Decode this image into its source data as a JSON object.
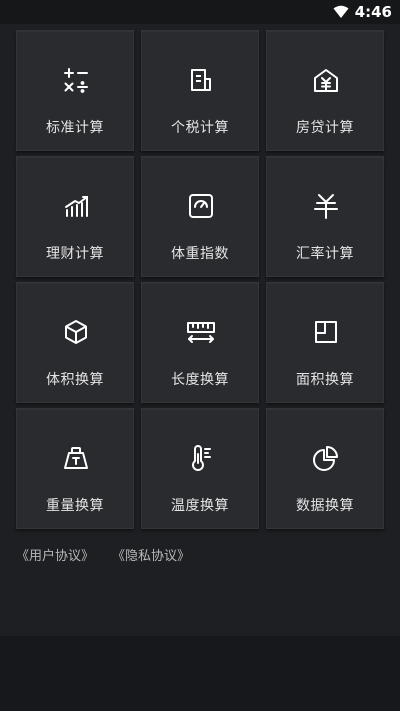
{
  "status_bar": {
    "time": "4:46",
    "icons": [
      "wifi-icon"
    ]
  },
  "tiles": [
    {
      "label": "标准计算",
      "icon": "calculator-symbols-icon"
    },
    {
      "label": "个税计算",
      "icon": "tax-document-icon"
    },
    {
      "label": "房贷计算",
      "icon": "house-yen-icon"
    },
    {
      "label": "理财计算",
      "icon": "growth-chart-icon"
    },
    {
      "label": "体重指数",
      "icon": "scale-dial-icon"
    },
    {
      "label": "汇率计算",
      "icon": "yen-icon"
    },
    {
      "label": "体积换算",
      "icon": "cube-icon"
    },
    {
      "label": "长度换算",
      "icon": "ruler-icon"
    },
    {
      "label": "面积换算",
      "icon": "area-square-icon"
    },
    {
      "label": "重量换算",
      "icon": "weight-icon"
    },
    {
      "label": "温度换算",
      "icon": "thermometer-icon"
    },
    {
      "label": "数据换算",
      "icon": "pie-chart-icon"
    }
  ],
  "footer_links": {
    "user_agreement": "《用户协议》",
    "privacy_agreement": "《隐私协议》"
  },
  "colors": {
    "background": "#1e1f22",
    "tile": "#2a2b2f",
    "text": "#e4e4e4",
    "icon": "#ffffff"
  }
}
